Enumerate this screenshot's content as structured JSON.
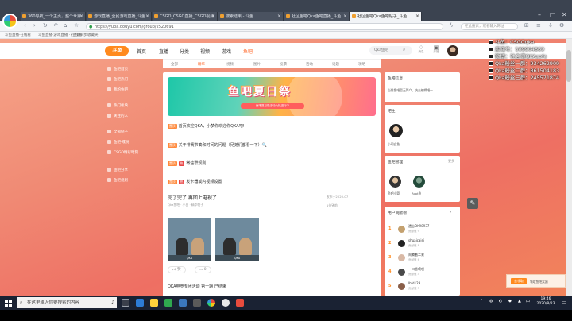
{
  "browser": {
    "tabs": [
      {
        "label": "360导航_一个主页，整个世界"
      },
      {
        "label": "游戏直播_全民游戏直播_斗鱼"
      },
      {
        "label": "CSGO_CSGO直播_CSGO视频"
      },
      {
        "label": "搜索结果 - 斗鱼"
      },
      {
        "label": "社区鱼吧Qka鱼吧直播_斗鱼"
      },
      {
        "label": "社区鱼吧Qka鱼吧帖子_斗鱼"
      }
    ],
    "window_controls": {
      "minimize": "–",
      "maximize": "□",
      "close": "✕"
    },
    "url": "https://yuba.douyu.com/group/2520691",
    "address_search_placeholder": "在此搜索，或者输入网址",
    "bookmarks": [
      "斗鱼直播·在线看",
      "斗鱼直播·游戏直播 · 在线看",
      "立即同步收藏夹"
    ]
  },
  "site": {
    "logo": "斗鱼",
    "nav": [
      "首页",
      "直播",
      "分类",
      "视频",
      "游戏",
      "鱼吧"
    ],
    "search_placeholder": "Qka鱼吧",
    "header_icons": [
      {
        "label": "消息"
      },
      {
        "label": "开播"
      }
    ]
  },
  "subnav": [
    "全部",
    "精华",
    "视频",
    "图片",
    "投票",
    "活动",
    "话题",
    "攻略"
  ],
  "leftnav": [
    "鱼吧首页",
    "鱼吧热门",
    "我的鱼吧",
    "热门板块",
    "关注的人",
    "全部帖子",
    "鱼吧·成员",
    "CSGO精彩时刻",
    "鱼吧分享",
    "鱼吧规则"
  ],
  "banner": {
    "title": "鱼吧夏日祭",
    "subtitle": "鱼吧夏日祭活动火热进行中"
  },
  "pinned": [
    {
      "badges": [
        "置顶"
      ],
      "text": "首页欢迎QKA，小梦你欢迎你QKA吧!"
    },
    {
      "badges": [
        "置顶"
      ],
      "text": "关于排赛节奏和时间的问题（兄弟们都看一下）🔍"
    },
    {
      "badges": [
        "置顶",
        "热"
      ],
      "text": "微信群规则"
    },
    {
      "badges": [
        "置顶",
        "热"
      ],
      "text": "发卡器或内视频设置"
    }
  ],
  "post": {
    "title": "完了完了 再回上电视了",
    "meta": "Qka鱼吧 · 小白 · 精华帖子",
    "time": "发布于2020-07",
    "reply_time": "1分钟前",
    "image_caption": "QKA",
    "like_label": "赞",
    "reply_count": "0"
  },
  "next_post": "QKA电竞专团活动 第一期 已结束",
  "cards": {
    "fish_bar": {
      "title": "鱼吧信息",
      "body": "当前鱼吧暂无简介，快去编辑吧～"
    },
    "host": {
      "title": "吧主",
      "name": "小明白鱼"
    },
    "managers": {
      "title": "鱼吧管理",
      "link": "更多",
      "names": [
        "鱼吧小管",
        "Root鱼"
      ]
    },
    "ranking": {
      "title": "用户贡献榜",
      "rows": [
        {
          "rank": "1",
          "name": "遗忘Oh98937",
          "sub": "贡献值 9"
        },
        {
          "rank": "2",
          "name": "shuaicaisi",
          "sub": "贡献值 8"
        },
        {
          "rank": "3",
          "name": "闹腾着二来",
          "sub": "贡献值 6"
        },
        {
          "rank": "4",
          "name": "一口香喷喷",
          "sub": "贡献值 4"
        },
        {
          "rank": "5",
          "name": "lbfd123",
          "sub": "贡献值 3"
        }
      ]
    }
  },
  "popup": {
    "button": "去领取",
    "text": "领取鱼吧奖励"
  },
  "overlay": [
    "斗鱼：CSGOqka",
    "房间号：589904869",
    "微博：社会湾QKAsofe",
    "Qka粉丝一群：934262909",
    "Qka粉丝二群：861504183",
    "Qka粉丝三群：245571874"
  ],
  "taskbar": {
    "search_placeholder": "在这里输入你要搜索的内容",
    "tray_lang": "中",
    "time": "19:46",
    "date": "2020/8/23",
    "apps": [
      "#2d7cd6",
      "#ffd23c",
      "#2fa84f",
      "#3b77bc",
      "#5a5a5a",
      "#e8e8e8",
      "#e84c3d"
    ]
  },
  "colors": {
    "accent": "#ff6a2b",
    "page_gradient": "#f08a74",
    "taskbar": "#1a2233"
  }
}
